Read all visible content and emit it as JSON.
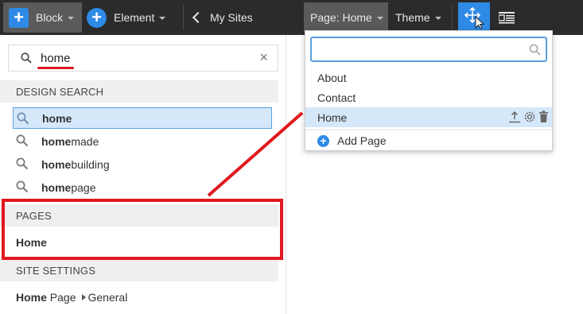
{
  "toolbar": {
    "block_label": "Block",
    "element_label": "Element",
    "my_sites_label": "My Sites",
    "page_label": "Page: Home",
    "theme_label": "Theme",
    "icons": {
      "block": "plus-square-icon",
      "element": "plus-circle-icon",
      "back": "chevron-left-icon",
      "move": "move-cursor-icon",
      "layout": "layout-list-icon"
    },
    "accent_color": "#2e8ae6"
  },
  "left_panel": {
    "search": {
      "value": "home",
      "placeholder": ""
    },
    "design_search": {
      "header": "DESIGN SEARCH",
      "results": [
        {
          "bold": "home",
          "rest": "",
          "selected": true
        },
        {
          "bold": "home",
          "rest": "made",
          "selected": false
        },
        {
          "bold": "home",
          "rest": "building",
          "selected": false
        },
        {
          "bold": "home",
          "rest": "page",
          "selected": false
        }
      ]
    },
    "pages": {
      "header": "PAGES",
      "items": [
        "Home"
      ]
    },
    "site_settings": {
      "header": "SITE SETTINGS",
      "row": {
        "bold": "Home",
        "rest": " Page",
        "sub": "General"
      }
    }
  },
  "page_dropdown": {
    "search_value": "",
    "items": [
      {
        "label": "About",
        "selected": false
      },
      {
        "label": "Contact",
        "selected": false
      },
      {
        "label": "Home",
        "selected": true
      }
    ],
    "add_label": "Add Page"
  },
  "annotation_color": "#e0191f"
}
